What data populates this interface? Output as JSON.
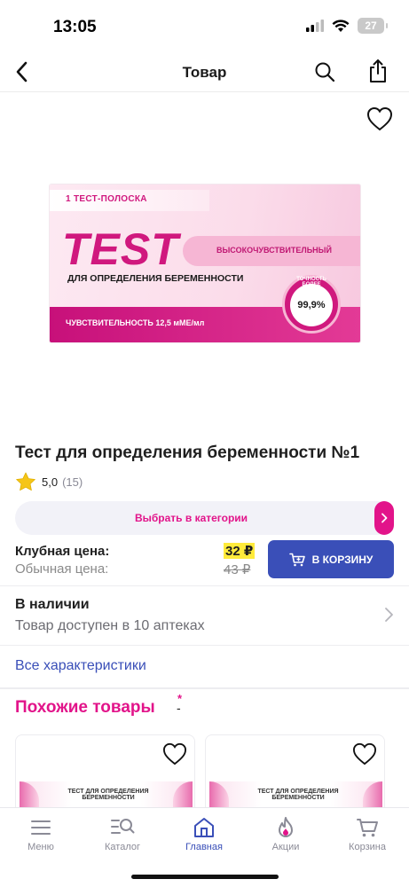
{
  "status_bar": {
    "time": "13:05",
    "battery": "27"
  },
  "header": {
    "title": "Товар",
    "back_icon": "chevron-left-icon",
    "search_icon": "search-icon",
    "share_icon": "share-icon"
  },
  "product": {
    "image_text": {
      "strip": "1 ТЕСТ-ПОЛОСКА",
      "brand": "TEST",
      "band": "ВЫСОКОЧУВСТВИТЕЛЬНЫЙ",
      "subtitle": "ДЛЯ ОПРЕДЕЛЕНИЯ БЕРЕМЕННОСТИ",
      "sensitivity": "ЧУВСТВИТЕЛЬНОСТЬ 12,5 мМЕ/мл",
      "accuracy_label": "ТОЧНОСТЬ БОЛЕЕ",
      "accuracy_value": "99,9%"
    },
    "title": "Тест для определения беременности №1",
    "rating": {
      "value": "5,0",
      "count": "(15)"
    },
    "category_button": "Выбрать в категории",
    "club_price_label": "Клубная цена:",
    "regular_price_label": "Обычная цена:",
    "club_price": "32 ₽",
    "regular_price": "43 ₽",
    "cart_button": "В КОРЗИНУ",
    "stock_title": "В наличии",
    "stock_subtitle": "Товар доступен в 10 аптеках",
    "specs_link": "Все характеристики"
  },
  "similar": {
    "title": "Похожие товары",
    "star": "*",
    "dash": "-",
    "cards": [
      {
        "pkg_text": "ТЕСТ ДЛЯ ОПРЕДЕЛЕНИЯ БЕРЕМЕННОСТИ"
      },
      {
        "pkg_text": "ТЕСТ ДЛЯ ОПРЕДЕЛЕНИЯ БЕРЕМЕННОСТИ"
      }
    ]
  },
  "tabs": [
    {
      "label": "Меню",
      "icon": "menu-icon"
    },
    {
      "label": "Каталог",
      "icon": "catalog-search-icon"
    },
    {
      "label": "Главная",
      "icon": "home-icon",
      "active": true
    },
    {
      "label": "Акции",
      "icon": "flame-icon"
    },
    {
      "label": "Корзина",
      "icon": "cart-icon"
    }
  ],
  "colors": {
    "accent_pink": "#e2148a",
    "accent_blue": "#3a4fb8",
    "price_highlight": "#ffeb3b"
  }
}
